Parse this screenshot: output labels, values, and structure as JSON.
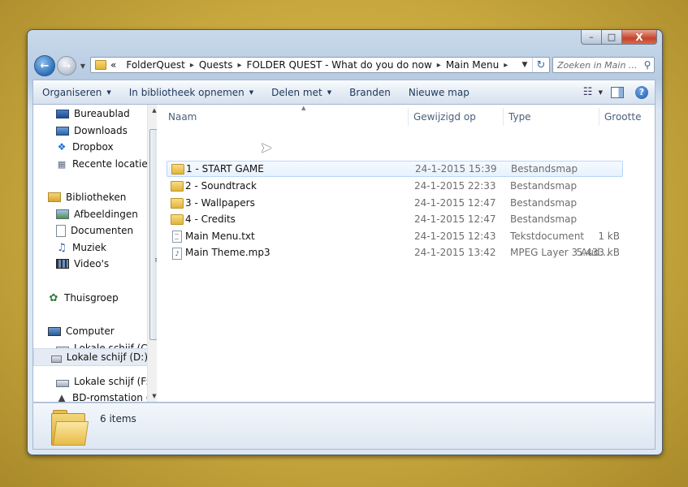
{
  "window": {
    "caption": {
      "minimize": "–",
      "maximize": "□",
      "close": "X"
    }
  },
  "address": {
    "prefix": "«",
    "crumbs": [
      "FolderQuest",
      "Quests",
      "FOLDER QUEST - What do you do now",
      "Main Menu"
    ]
  },
  "search": {
    "placeholder": "Zoeken in Main ..."
  },
  "toolbar": {
    "organise": "Organiseren",
    "include_library": "In bibliotheek opnemen",
    "share_with": "Delen met",
    "burn": "Branden",
    "new_folder": "Nieuwe map",
    "help": "?"
  },
  "nav": {
    "favorites": [
      "Bureaublad",
      "Downloads",
      "Dropbox",
      "Recente locaties"
    ],
    "libraries_title": "Bibliotheken",
    "libraries": [
      "Afbeeldingen",
      "Documenten",
      "Muziek",
      "Video's"
    ],
    "homegroup": "Thuisgroep",
    "computer_title": "Computer",
    "drives": [
      "Lokale schijf (C:)",
      "Lokale schijf (D:)",
      "Lokale schijf (F:)",
      "BD-romstation (G"
    ]
  },
  "columns": {
    "name": "Naam",
    "modified": "Gewijzigd op",
    "type": "Type",
    "size": "Grootte"
  },
  "files": [
    {
      "name": "1 - START GAME",
      "modified": "24-1-2015 15:39",
      "type": "Bestandsmap",
      "size": "",
      "icon": "folder-icon"
    },
    {
      "name": "2 - Soundtrack",
      "modified": "24-1-2015 22:33",
      "type": "Bestandsmap",
      "size": "",
      "icon": "folder-icon"
    },
    {
      "name": "3 - Wallpapers",
      "modified": "24-1-2015 12:47",
      "type": "Bestandsmap",
      "size": "",
      "icon": "folder-icon"
    },
    {
      "name": "4 - Credits",
      "modified": "24-1-2015 12:47",
      "type": "Bestandsmap",
      "size": "",
      "icon": "folder-icon"
    },
    {
      "name": "Main Menu.txt",
      "modified": "24-1-2015 12:43",
      "type": "Tekstdocument",
      "size": "1 kB",
      "icon": "text-file-icon"
    },
    {
      "name": "Main Theme.mp3",
      "modified": "24-1-2015 13:42",
      "type": "MPEG Layer 3 Aud...",
      "size": "5.433 kB",
      "icon": "audio-file-icon"
    }
  ],
  "status": {
    "item_count": "6 items"
  }
}
